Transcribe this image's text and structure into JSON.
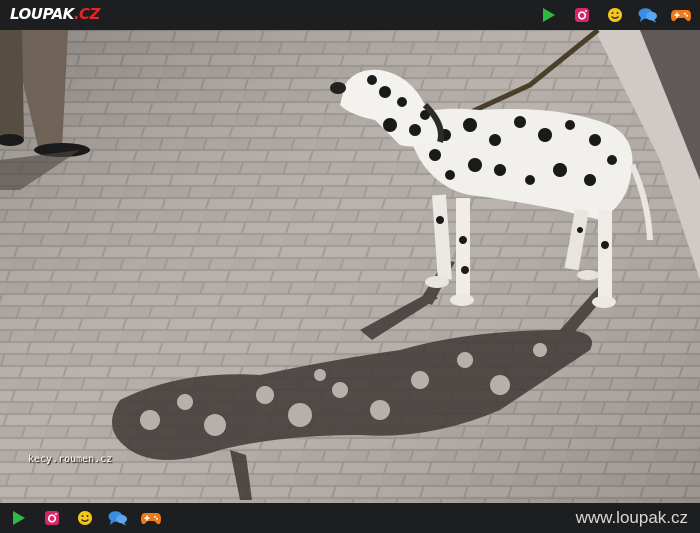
{
  "header": {
    "logo_main": "LOUPAK",
    "logo_suffix": ".CZ",
    "icons": [
      "play-icon",
      "instagram-icon",
      "smiley-icon",
      "chat-bubbles-icon",
      "gamepad-icon"
    ]
  },
  "photo": {
    "watermark": "kecy.roumen.cz"
  },
  "footer": {
    "site_url": "www.loupak.cz",
    "icons": [
      "play-icon",
      "instagram-icon",
      "smiley-icon",
      "chat-bubbles-icon",
      "gamepad-icon"
    ]
  },
  "colors": {
    "bar_bg": "#1d1e20",
    "play": "#2fb944",
    "instagram": "#d8266a",
    "smiley": "#f5c518",
    "chat": "#3a8de0",
    "gamepad": "#f07a1a",
    "logo_accent": "#e8242a"
  }
}
